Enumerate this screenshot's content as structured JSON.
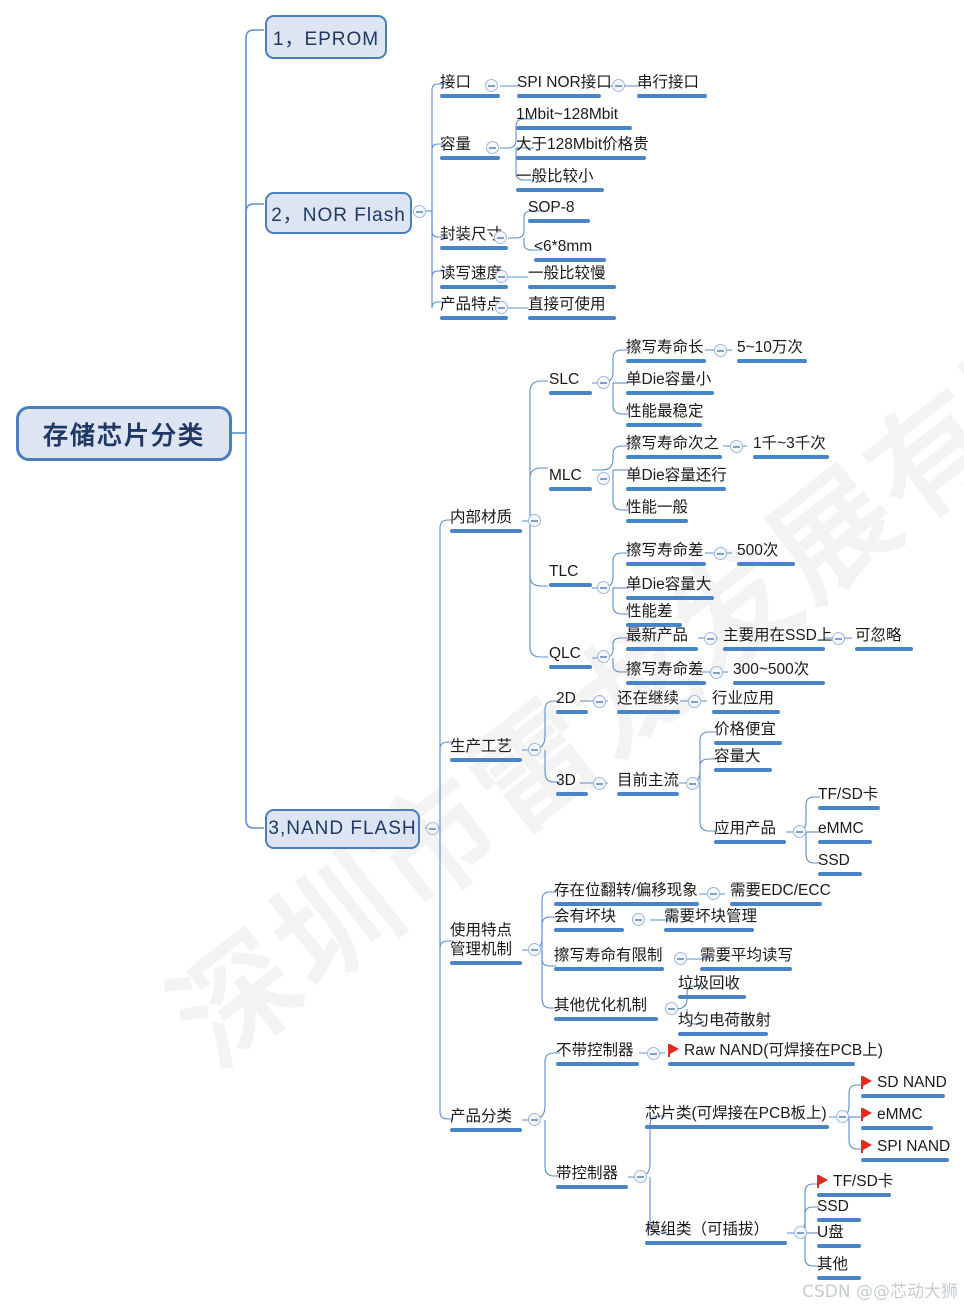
{
  "title": "存储芯片分类",
  "watermark": {
    "background": "深圳市雷龙发展有限公司",
    "corner": "CSDN @@芯动大狮"
  },
  "colors": {
    "node_fill": "#DDE5F2",
    "node_border": "#4A7EBC",
    "underline": "#4A84C8",
    "connector": "#5B8FD0",
    "flag": "#E02B20",
    "text": "#1a1a1a",
    "root_text": "#1F3864"
  },
  "root": {
    "label": "存储芯片分类"
  },
  "branches": [
    {
      "label": "1，EPROM"
    },
    {
      "label": "2，NOR Flash"
    },
    {
      "label": "3,NAND FLASH"
    }
  ],
  "nodes": {
    "nor": {
      "interface": "接口",
      "interface_c1": "SPI NOR接口",
      "interface_c2": "串行接口",
      "capacity": "容量",
      "capacity_c1": "1Mbit~128Mbit",
      "capacity_c2": "大于128Mbit价格贵",
      "capacity_c3": "一般比较小",
      "package": "封装尺寸",
      "package_c1": "SOP-8",
      "package_c2": "<6*8mm",
      "speed": "读写速度",
      "speed_c1": "一般比较慢",
      "feature": "产品特点",
      "feature_c1": "直接可使用"
    },
    "nand": {
      "material": "内部材质",
      "slc": "SLC",
      "slc_c1": "擦写寿命长",
      "slc_c1_c1": "5~10万次",
      "slc_c2": "单Die容量小",
      "slc_c3": "性能最稳定",
      "mlc": "MLC",
      "mlc_c1": "擦写寿命次之",
      "mlc_c1_c1": "1千~3千次",
      "mlc_c2": "单Die容量还行",
      "mlc_c3": "性能一般",
      "tlc": "TLC",
      "tlc_c1": "擦写寿命差",
      "tlc_c1_c1": "500次",
      "tlc_c2": "单Die容量大",
      "tlc_c3": "性能差",
      "qlc": "QLC",
      "qlc_c1": "最新产品",
      "qlc_c1_c1": "主要用在SSD上",
      "qlc_c1_c1_c1": "可忽略",
      "qlc_c2": "擦写寿命差",
      "qlc_c2_c1": "300~500次",
      "process": "生产工艺",
      "p2d": "2D",
      "p2d_c1": "还在继续",
      "p2d_c1_c1": "行业应用",
      "p3d": "3D",
      "p3d_c1": "目前主流",
      "p3d_c1_c1": "价格便宜",
      "p3d_c1_c2": "容量大",
      "p3d_c1_c3": "应用产品",
      "p3d_app_1": "TF/SD卡",
      "p3d_app_2": "eMMC",
      "p3d_app_3": "SSD",
      "usage_line1": "使用特点",
      "usage_line2": "管理机制",
      "u_c1": "存在位翻转/偏移现象",
      "u_c1_c1": "需要EDC/ECC",
      "u_c2": "会有坏块",
      "u_c2_c1": "需要坏块管理",
      "u_c3": "擦写寿命有限制",
      "u_c3_c1": "需要平均读写",
      "u_c4": "其他优化机制",
      "u_c4_c1": "垃圾回收",
      "u_c4_c2": "均匀电荷散射",
      "category": "产品分类",
      "no_ctrl": "不带控制器",
      "no_ctrl_c1": "Raw NAND(可焊接在PCB上)",
      "with_ctrl": "带控制器",
      "chip_type": "芯片类(可焊接在PCB板上)",
      "chip_1": "SD NAND",
      "chip_2": "eMMC",
      "chip_3": "SPI NAND",
      "module_type": "模组类（可插拔）",
      "module_1": "TF/SD卡",
      "module_2": "SSD",
      "module_3": "U盘",
      "module_4": "其他"
    }
  }
}
